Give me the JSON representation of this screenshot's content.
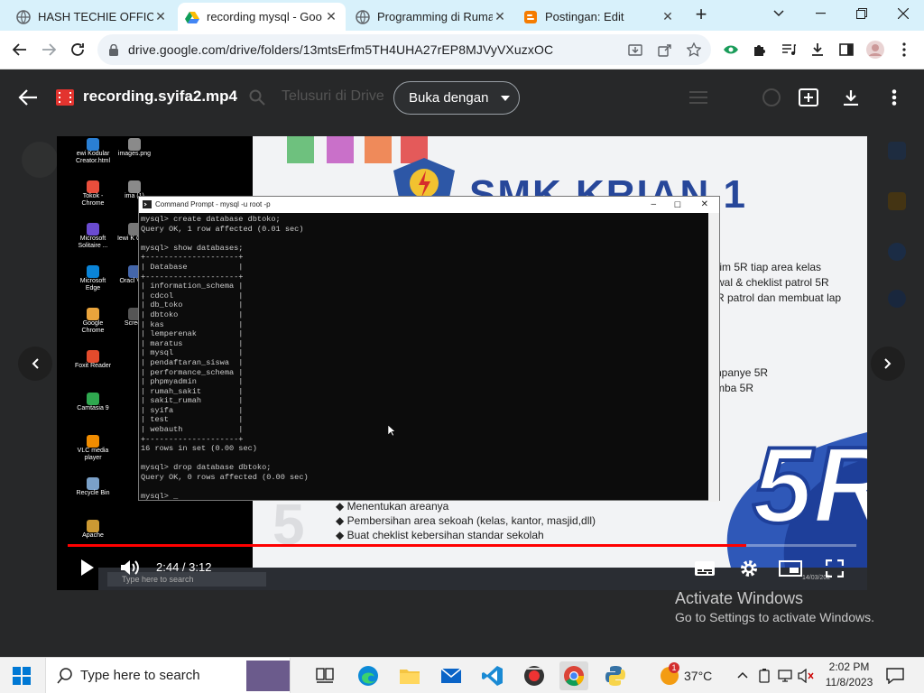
{
  "browser": {
    "tabs": [
      {
        "title": "HASH TECHIE OFFICIA",
        "active": false
      },
      {
        "title": "recording mysql - Goo",
        "active": true
      },
      {
        "title": "Programming di Ruma",
        "active": false
      },
      {
        "title": "Postingan: Edit",
        "active": false
      }
    ],
    "url": "drive.google.com/drive/folders/13mtsErfm5TH4UHA27rEP8MJVyVXuzxOC"
  },
  "drive": {
    "file_title": "recording.syifa2.mp4",
    "search_placeholder": "Telusuri di Drive",
    "open_with_label": "Buka dengan"
  },
  "video": {
    "current_time": "2:44",
    "duration": "3:12",
    "time_display": "2:44 / 3:12",
    "progress_fraction": 0.86,
    "desktop_icons": [
      "ewi Kodular Creator.html",
      "images.png",
      "Tokok - Chrome",
      "ima (1)",
      "Microsoft Solitaire ...",
      "Iewi K Creat",
      "Microsoft Edge",
      "Oracl Virtu",
      "Google Chrome",
      "Screen",
      "Foxit Reader",
      "Camtasia 9",
      "VLC media player",
      "Recycle Bin",
      "Apache"
    ],
    "cmd": {
      "title": "Command Prompt - mysql -u root -p",
      "lines": [
        "mysql> create database dbtoko;",
        "Query OK, 1 row affected (0.01 sec)",
        "",
        "mysql> show databases;",
        "+--------------------+",
        "| Database           |",
        "+--------------------+",
        "| information_schema |",
        "| cdcol              |",
        "| db_toko            |",
        "| dbtoko             |",
        "| kas                |",
        "| lemperenak         |",
        "| maratus            |",
        "| mysql              |",
        "| pendaftaran_siswa  |",
        "| performance_schema |",
        "| phpmyadmin         |",
        "| rumah_sakit        |",
        "| sakit_rumah        |",
        "| syifa              |",
        "| test               |",
        "| webauth            |",
        "+--------------------+",
        "16 rows in set (0.00 sec)",
        "",
        "mysql> drop database dbtoko;",
        "Query OK, 0 rows affected (0.00 sec)",
        "",
        "mysql> _"
      ]
    },
    "slide": {
      "heading": "SMK KRIAN 1",
      "right_lines": [
        "tim 5R tiap area kelas",
        "wal & cheklist patrol 5R",
        "R patrol dan membuat lap"
      ],
      "mid_lines": [
        "npanye 5R",
        "mba 5R"
      ],
      "bullets": [
        "Menentukan areanya",
        "Pembersihan area sekoah (kelas, kantor, masjid,dll)",
        "Buat cheklist kebersihan standar sekolah"
      ],
      "big_mark": "5R"
    },
    "inner_taskbar_search": "Type here to search",
    "inner_clock": "14/03/202"
  },
  "watermark": {
    "line1": "Activate Windows",
    "line2": "Go to Settings to activate Windows."
  },
  "taskbar": {
    "search_text": "Type here to search",
    "weather_temp": "37°C",
    "weather_badge": "1",
    "time": "2:02 PM",
    "date": "11/8/2023"
  },
  "colors": {
    "tabstrip": "#d8f1fb",
    "progress": "#ff0000",
    "drive_overlay": "#2b2b2b",
    "taskbar": "#f2f2f2"
  }
}
